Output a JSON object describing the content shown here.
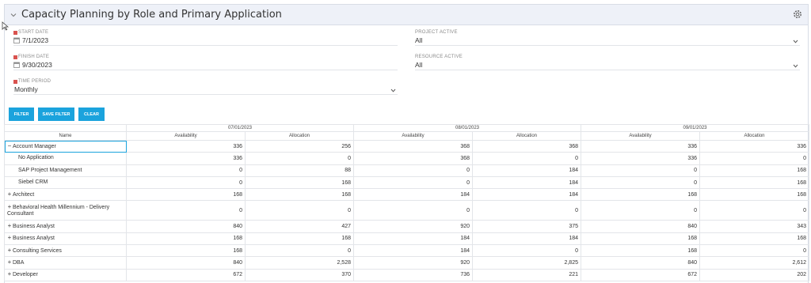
{
  "header": {
    "title": "Capacity Planning by Role and Primary Application"
  },
  "filters": {
    "start_date": {
      "label": "START DATE",
      "value": "7/1/2023"
    },
    "finish_date": {
      "label": "FINISH DATE",
      "value": "9/30/2023"
    },
    "time_period": {
      "label": "TIME PERIOD",
      "value": "Monthly"
    },
    "project_active": {
      "label": "PROJECT ACTIVE",
      "value": "All"
    },
    "resource_active": {
      "label": "RESOURCE ACTIVE",
      "value": "All"
    }
  },
  "buttons": {
    "filter": "FILTER",
    "save_filter": "SAVE FILTER",
    "clear": "CLEAR"
  },
  "grid": {
    "name_header": "Name",
    "months": [
      "07/01/2023",
      "08/01/2023",
      "09/01/2023"
    ],
    "sub_headers": [
      "Availability",
      "Allocation"
    ],
    "rows": [
      {
        "name": "Account Manager",
        "expander": "−",
        "child": false,
        "values": [
          "336",
          "256",
          "368",
          "368",
          "336",
          "336"
        ]
      },
      {
        "name": "No Application",
        "expander": "",
        "child": true,
        "values": [
          "336",
          "0",
          "368",
          "0",
          "336",
          "0"
        ]
      },
      {
        "name": "SAP Project Management",
        "expander": "",
        "child": true,
        "values": [
          "0",
          "88",
          "0",
          "184",
          "0",
          "168"
        ]
      },
      {
        "name": "Siebel CRM",
        "expander": "",
        "child": true,
        "values": [
          "0",
          "168",
          "0",
          "184",
          "0",
          "168"
        ]
      },
      {
        "name": "Architect",
        "expander": "+",
        "child": false,
        "values": [
          "168",
          "168",
          "184",
          "184",
          "168",
          "168"
        ]
      },
      {
        "name": "Behavioral Health Millennium - Delivery Consultant",
        "expander": "+",
        "child": false,
        "values": [
          "0",
          "0",
          "0",
          "0",
          "0",
          "0"
        ]
      },
      {
        "name": "Business Analyst",
        "expander": "+",
        "child": false,
        "values": [
          "840",
          "427",
          "920",
          "375",
          "840",
          "343"
        ]
      },
      {
        "name": "Business Analyst",
        "expander": "+",
        "child": false,
        "values": [
          "168",
          "168",
          "184",
          "184",
          "168",
          "168"
        ]
      },
      {
        "name": "Consulting Services",
        "expander": "+",
        "child": false,
        "values": [
          "168",
          "0",
          "184",
          "0",
          "168",
          "0"
        ]
      },
      {
        "name": "DBA",
        "expander": "+",
        "child": false,
        "values": [
          "840",
          "2,528",
          "920",
          "2,825",
          "840",
          "2,612"
        ]
      },
      {
        "name": "Developer",
        "expander": "+",
        "child": false,
        "values": [
          "672",
          "370",
          "736",
          "221",
          "672",
          "202"
        ]
      }
    ]
  }
}
